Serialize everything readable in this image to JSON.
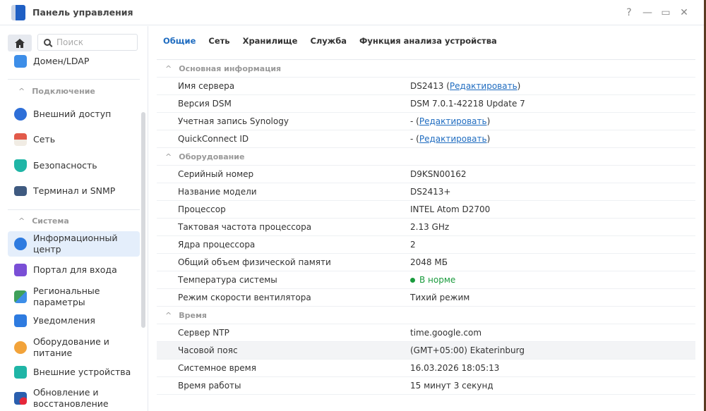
{
  "window": {
    "title": "Панель управления",
    "buttons": [
      "?",
      "—",
      "▭",
      "✕"
    ]
  },
  "sidebar": {
    "search_placeholder": "Поиск",
    "top_item": "Домен/LDAP",
    "sections": [
      {
        "title": "Подключение",
        "items": [
          "Внешний доступ",
          "Сеть",
          "Безопасность",
          "Терминал и SNMP"
        ]
      },
      {
        "title": "Система",
        "items": [
          "Информационный центр",
          "Портал для входа",
          "Региональные параметры",
          "Уведомления",
          "Оборудование и питание",
          "Внешние устройства",
          "Обновление и восстановление"
        ]
      }
    ]
  },
  "tabs": [
    "Общие",
    "Сеть",
    "Хранилище",
    "Служба",
    "Функция анализа устройства"
  ],
  "sections": [
    {
      "title": "Основная информация",
      "rows": [
        {
          "k": "Имя сервера",
          "v": "DS2413 (",
          "link": "Редактировать",
          "tail": ")"
        },
        {
          "k": "Версия DSM",
          "v": "DSM 7.0.1-42218 Update 7"
        },
        {
          "k": "Учетная запись Synology",
          "v": "- (",
          "link": "Редактировать",
          "tail": ")"
        },
        {
          "k": "QuickConnect ID",
          "v": "- (",
          "link": "Редактировать",
          "tail": ")"
        }
      ]
    },
    {
      "title": "Оборудование",
      "rows": [
        {
          "k": "Серийный номер",
          "v": "D9KSN00162"
        },
        {
          "k": "Название модели",
          "v": "DS2413+"
        },
        {
          "k": "Процессор",
          "v": "INTEL Atom D2700"
        },
        {
          "k": "Тактовая частота процессора",
          "v": "2.13 GHz"
        },
        {
          "k": "Ядра процессора",
          "v": "2"
        },
        {
          "k": "Общий объем физической памяти",
          "v": "2048 МБ"
        },
        {
          "k": "Температура системы",
          "v": "В норме",
          "status": "ok"
        },
        {
          "k": "Режим скорости вентилятора",
          "v": "Тихий режим"
        }
      ]
    },
    {
      "title": "Время",
      "rows": [
        {
          "k": "Сервер NTP",
          "v": "time.google.com"
        },
        {
          "k": "Часовой пояс",
          "v": "(GMT+05:00) Ekaterinburg",
          "hl": true
        },
        {
          "k": "Системное время",
          "v": "16.03.2026 18:05:13"
        },
        {
          "k": "Время работы",
          "v": "15 минут 3 секунд"
        }
      ]
    }
  ],
  "colors": {
    "accent": "#1f6cc0",
    "ok": "#1a9b3d"
  }
}
